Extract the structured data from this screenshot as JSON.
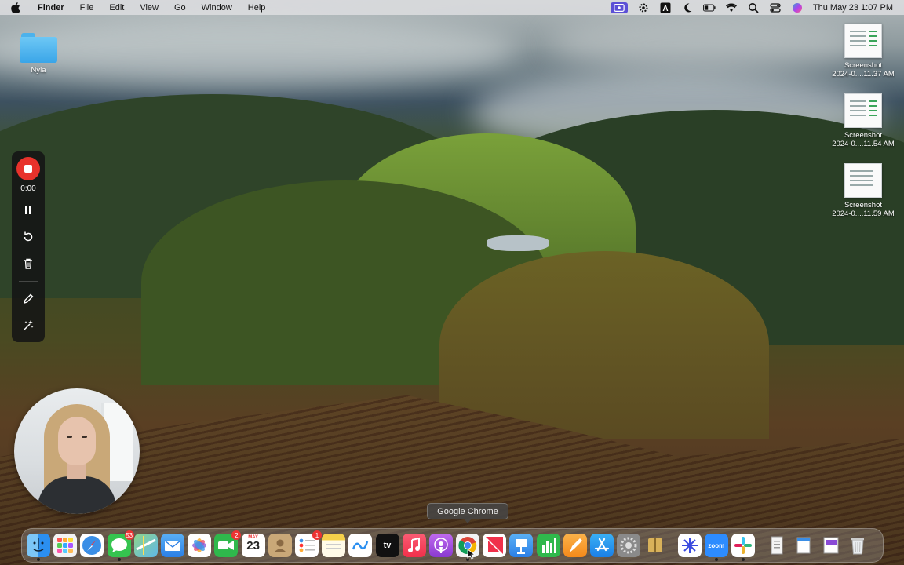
{
  "menubar": {
    "app_name": "Finder",
    "items": [
      "File",
      "Edit",
      "View",
      "Go",
      "Window",
      "Help"
    ],
    "clock": "Thu May 23  1:07 PM",
    "status_icons": [
      "screen-record-icon",
      "gear-icon",
      "text-input-icon",
      "moon-icon",
      "battery-icon",
      "wifi-icon",
      "search-icon",
      "control-center-icon",
      "siri-icon"
    ]
  },
  "desktop": {
    "folder": {
      "name": "Nyla"
    },
    "files": [
      {
        "line1": "Screenshot",
        "line2": "2024-0....11.37 AM"
      },
      {
        "line1": "Screenshot",
        "line2": "2024-0....11.54 AM"
      },
      {
        "line1": "Screenshot",
        "line2": "2024-0....11.59 AM"
      }
    ]
  },
  "recorder": {
    "elapsed": "0:00",
    "tools": [
      "pause-icon",
      "restart-icon",
      "trash-icon",
      "pencil-icon",
      "sparkle-icon"
    ]
  },
  "tooltip": {
    "label": "Google Chrome"
  },
  "dock": {
    "calendar": {
      "month": "MAY",
      "day": "23"
    },
    "badges": {
      "messages": "53",
      "facetime": "2",
      "reminders": "1"
    },
    "apps": [
      {
        "name": "Finder",
        "color": "#2b8ff0"
      },
      {
        "name": "Launchpad",
        "color": "#e86a4a"
      },
      {
        "name": "Safari",
        "color": "#3a8ee6"
      },
      {
        "name": "Messages",
        "color": "#35c44f"
      },
      {
        "name": "Maps",
        "color": "#5fb8e8"
      },
      {
        "name": "Mail",
        "color": "#3a8ee6"
      },
      {
        "name": "Photos",
        "color": "#f2c23a"
      },
      {
        "name": "FaceTime",
        "color": "#2fb84c"
      },
      {
        "name": "Calendar",
        "color": "#ffffff"
      },
      {
        "name": "Contacts",
        "color": "#b08a5a"
      },
      {
        "name": "Reminders",
        "color": "#f2f2f2"
      },
      {
        "name": "Notes",
        "color": "#f5d04a"
      },
      {
        "name": "Freeform",
        "color": "#ffffff"
      },
      {
        "name": "TV",
        "color": "#111111"
      },
      {
        "name": "Music",
        "color": "#f5405a"
      },
      {
        "name": "Podcasts",
        "color": "#9a4ad8"
      },
      {
        "name": "Google Chrome",
        "color": "#ffffff"
      },
      {
        "name": "News",
        "color": "#f0304a"
      },
      {
        "name": "Keynote",
        "color": "#2b8ff0"
      },
      {
        "name": "Numbers",
        "color": "#2fb84c"
      },
      {
        "name": "Pages",
        "color": "#f59a2a"
      },
      {
        "name": "App Store",
        "color": "#2b8ff0"
      },
      {
        "name": "System Settings",
        "color": "#7a7a7a"
      },
      {
        "name": "Archive Utility",
        "color": "#d9b25a"
      },
      {
        "name": "Perplexity",
        "color": "#ffffff"
      },
      {
        "name": "Zoom",
        "color": "#2d8cff"
      },
      {
        "name": "Slack",
        "color": "#ffffff"
      }
    ],
    "zoom_label": "zoom"
  },
  "colors": {
    "record_red": "#e8322b",
    "accent_purple": "#5b4fd6"
  }
}
